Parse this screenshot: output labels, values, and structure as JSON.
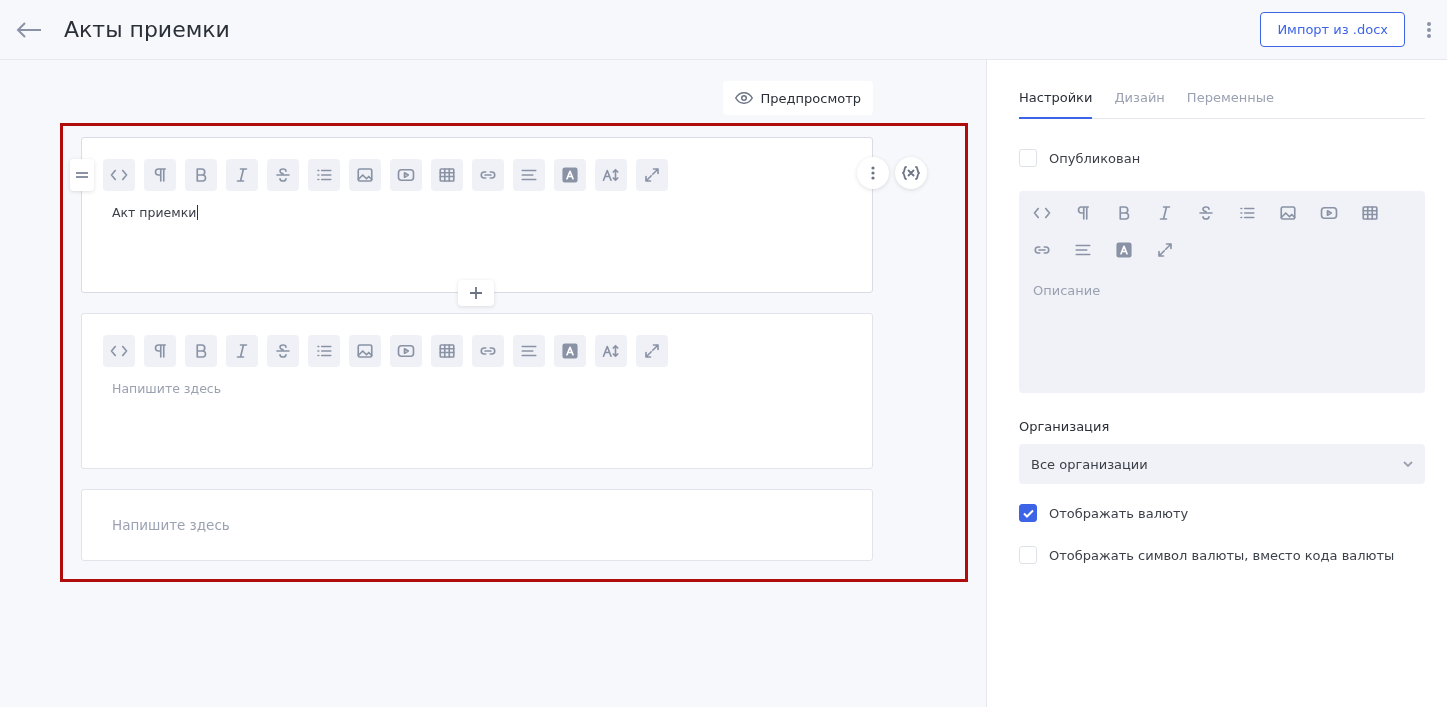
{
  "header": {
    "title": "Акты приемки",
    "import_button": "Импорт из .docx"
  },
  "preview_button": "Предпросмотр",
  "blocks": [
    {
      "kind": "toolbar",
      "focused": true,
      "value": "Акт приемки"
    },
    {
      "kind": "toolbar",
      "focused": false,
      "placeholder": "Напишите здесь"
    },
    {
      "kind": "plain",
      "focused": false,
      "placeholder": "Напишите здесь"
    }
  ],
  "panel": {
    "tabs": [
      {
        "label": "Настройки",
        "selected": true
      },
      {
        "label": "Дизайн",
        "selected": false
      },
      {
        "label": "Переменные",
        "selected": false
      }
    ],
    "published": {
      "label": "Опубликован",
      "checked": false
    },
    "description": {
      "placeholder": "Описание"
    },
    "organization": {
      "label": "Организация",
      "value": "Все организации"
    },
    "options": [
      {
        "label": "Отображать валюту",
        "checked": true
      },
      {
        "label": "Отображать символ валюты, вместо кода валюты",
        "checked": false
      }
    ]
  }
}
